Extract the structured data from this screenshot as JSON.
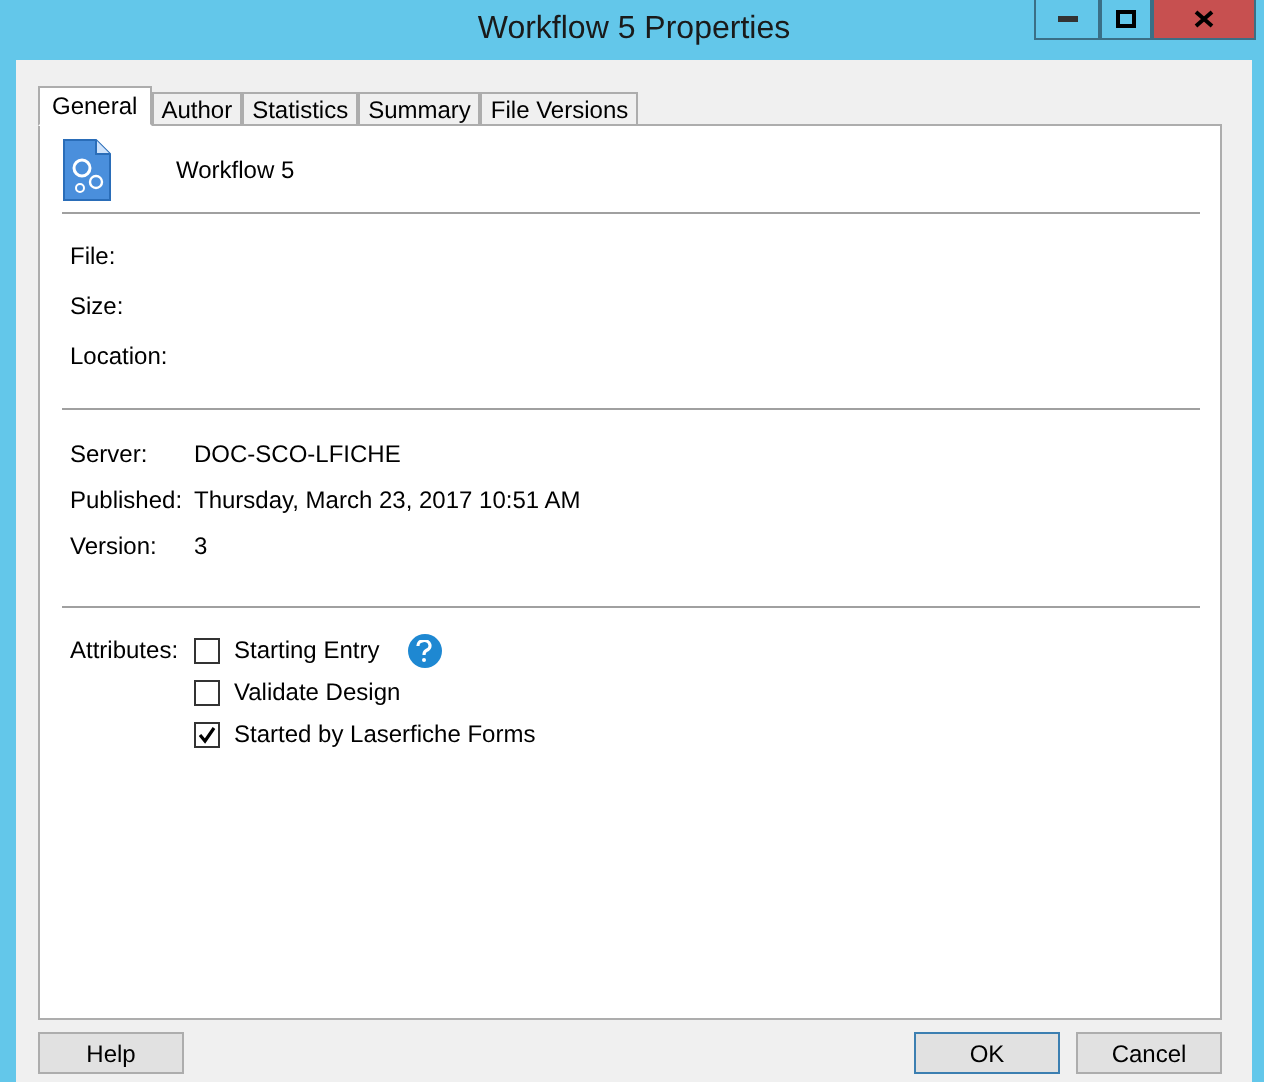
{
  "window": {
    "title": "Workflow 5 Properties"
  },
  "tabs": [
    {
      "label": "General",
      "selected": true
    },
    {
      "label": "Author",
      "selected": false
    },
    {
      "label": "Statistics",
      "selected": false
    },
    {
      "label": "Summary",
      "selected": false
    },
    {
      "label": "File Versions",
      "selected": false
    }
  ],
  "header": {
    "name": "Workflow 5"
  },
  "file_info": [
    {
      "label": "File:"
    },
    {
      "label": "Size:"
    },
    {
      "label": "Location:"
    }
  ],
  "server_info": [
    {
      "label": "Server:",
      "value": "DOC-SCO-LFICHE"
    },
    {
      "label": "Published:",
      "value": "Thursday, March 23, 2017 10:51 AM"
    },
    {
      "label": "Version:",
      "value": "3"
    }
  ],
  "attributes": {
    "label": "Attributes:",
    "options": [
      {
        "label": "Starting Entry",
        "checked": false,
        "help": true
      },
      {
        "label": "Validate Design",
        "checked": false,
        "help": false
      },
      {
        "label": "Started by Laserfiche Forms",
        "checked": true,
        "help": false
      }
    ]
  },
  "buttons": {
    "left": [
      "Help"
    ],
    "right": [
      {
        "label": "OK",
        "default": true
      },
      {
        "label": "Cancel",
        "default": false
      }
    ]
  }
}
